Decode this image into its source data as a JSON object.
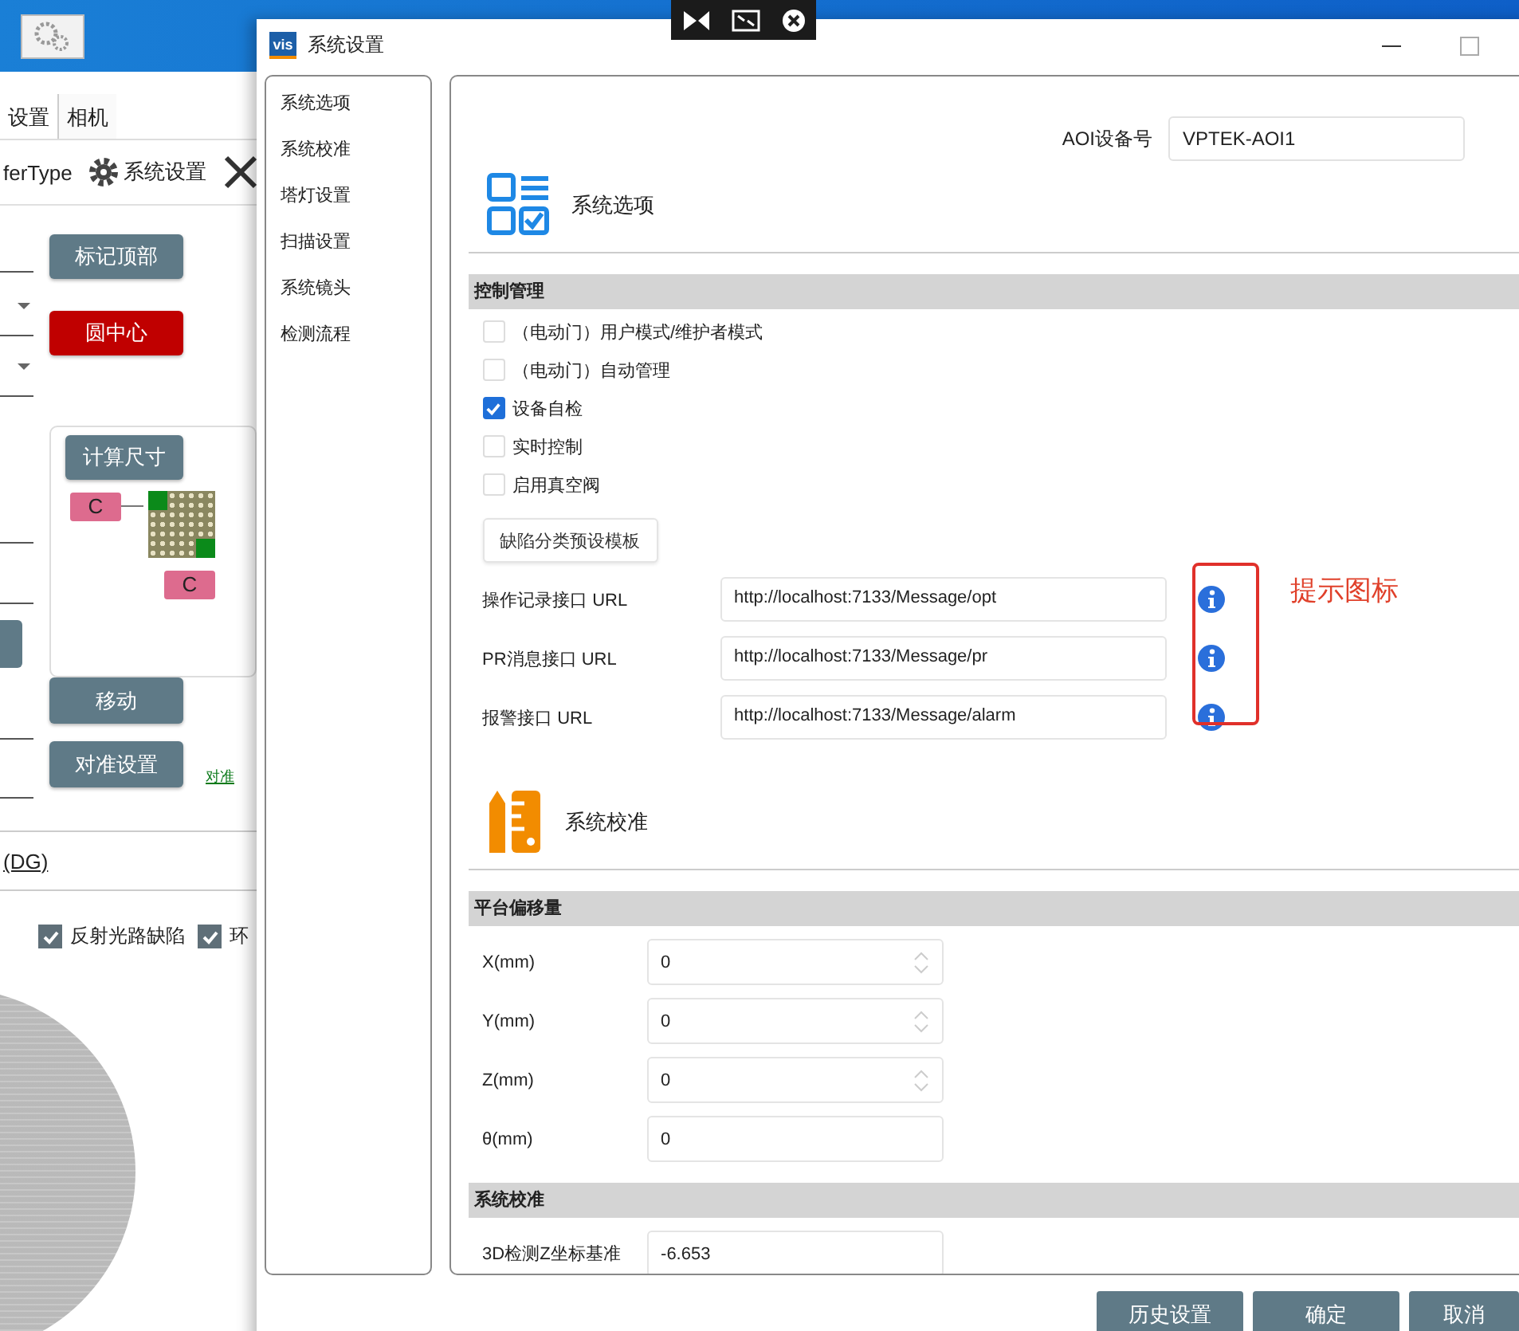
{
  "background_app": {
    "tabs": [
      {
        "label": "设置",
        "selected": true
      },
      {
        "label": "相机",
        "selected": false
      }
    ],
    "toolbar": {
      "partial_label": "ferType",
      "settings_label": "系统设置"
    },
    "buttons": [
      {
        "label": "标记顶部",
        "color": "#5f7a87"
      },
      {
        "label": "圆中心",
        "color": "#c00000"
      }
    ],
    "measure_panel": {
      "button": "计算尺寸",
      "markers": [
        "C",
        "C"
      ]
    },
    "action_buttons": [
      {
        "label": "移动",
        "color": "#5f7a87"
      },
      {
        "label": "对准设置",
        "color": "#5f7a87"
      }
    ],
    "side_link": "对准",
    "link": "(DG)",
    "checkboxes": [
      {
        "label": "反射光路缺陷",
        "checked": true
      },
      {
        "label": "环",
        "checked": true
      }
    ]
  },
  "dialog": {
    "title": "系统设置",
    "logo_text": "vis",
    "nav": [
      "系统选项",
      "系统校准",
      "塔灯设置",
      "扫描设置",
      "系统镜头",
      "检测流程"
    ],
    "device": {
      "label": "AOI设备号",
      "value": "VPTEK-AOI1"
    },
    "options_section": {
      "title": "系统选项",
      "group": "控制管理",
      "checkboxes": [
        {
          "label": "（电动门）用户模式/维护者模式",
          "checked": false
        },
        {
          "label": "（电动门）自动管理",
          "checked": false
        },
        {
          "label": "设备自检",
          "checked": true
        },
        {
          "label": "实时控制",
          "checked": false
        },
        {
          "label": "启用真空阀",
          "checked": false
        }
      ],
      "template_button": "缺陷分类预设模板",
      "url_fields": [
        {
          "label": "操作记录接口 URL",
          "value": "http://localhost:7133/Message/opt"
        },
        {
          "label": "PR消息接口 URL",
          "value": "http://localhost:7133/Message/pr"
        },
        {
          "label": "报警接口 URL",
          "value": "http://localhost:7133/Message/alarm"
        }
      ]
    },
    "annotation": {
      "text": "提示图标"
    },
    "calibration_section": {
      "title": "系统校准",
      "groups": [
        {
          "title": "平台偏移量",
          "fields": [
            {
              "label": "X(mm)",
              "value": "0",
              "spinner": true
            },
            {
              "label": "Y(mm)",
              "value": "0",
              "spinner": true
            },
            {
              "label": "Z(mm)",
              "value": "0",
              "spinner": true
            },
            {
              "label": "θ(mm)",
              "value": "0",
              "spinner": false
            }
          ]
        },
        {
          "title": "系统校准",
          "fields": [
            {
              "label": "3D检测Z坐标基准",
              "value": "-6.653",
              "spinner": false
            }
          ]
        }
      ]
    },
    "footer_buttons": [
      "历史设置",
      "确定",
      "取消"
    ]
  }
}
